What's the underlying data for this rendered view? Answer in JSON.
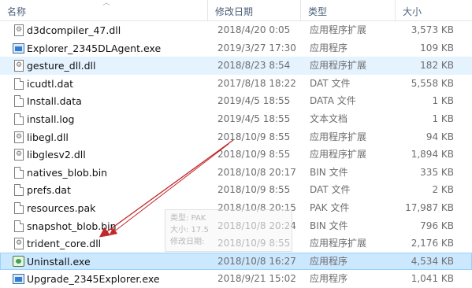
{
  "columns": {
    "name": "名称",
    "modified": "修改日期",
    "type": "类型",
    "size": "大小"
  },
  "files": [
    {
      "name": "d3dcompiler_47.dll",
      "date": "2018/4/20 0:05",
      "type": "应用程序扩展",
      "size": "3,573 KB",
      "icon": "gear-file-icon",
      "state": "normal"
    },
    {
      "name": "Explorer_2345DLAgent.exe",
      "date": "2019/3/27 17:30",
      "type": "应用程序",
      "size": "109 KB",
      "icon": "exe-icon",
      "state": "normal"
    },
    {
      "name": "gesture_dll.dll",
      "date": "2018/8/23 8:54",
      "type": "应用程序扩展",
      "size": "182 KB",
      "icon": "gear-file-icon",
      "state": "hover"
    },
    {
      "name": "icudtl.dat",
      "date": "2017/8/18 18:22",
      "type": "DAT 文件",
      "size": "5,558 KB",
      "icon": "document-icon",
      "state": "normal"
    },
    {
      "name": "Install.data",
      "date": "2019/4/5 18:55",
      "type": "DATA 文件",
      "size": "1 KB",
      "icon": "document-icon",
      "state": "normal"
    },
    {
      "name": "install.log",
      "date": "2019/4/5 18:55",
      "type": "文本文档",
      "size": "1 KB",
      "icon": "document-icon",
      "state": "normal"
    },
    {
      "name": "libegl.dll",
      "date": "2018/10/9 8:55",
      "type": "应用程序扩展",
      "size": "94 KB",
      "icon": "gear-file-icon",
      "state": "normal"
    },
    {
      "name": "libglesv2.dll",
      "date": "2018/10/9 8:55",
      "type": "应用程序扩展",
      "size": "1,894 KB",
      "icon": "gear-file-icon",
      "state": "normal"
    },
    {
      "name": "natives_blob.bin",
      "date": "2018/10/8 20:17",
      "type": "BIN 文件",
      "size": "335 KB",
      "icon": "document-icon",
      "state": "normal"
    },
    {
      "name": "prefs.dat",
      "date": "2018/10/9 8:55",
      "type": "DAT 文件",
      "size": "2 KB",
      "icon": "document-icon",
      "state": "normal"
    },
    {
      "name": "resources.pak",
      "date": "2018/10/8 20:15",
      "type": "PAK 文件",
      "size": "17,987 KB",
      "icon": "document-icon",
      "state": "normal"
    },
    {
      "name": "snapshot_blob.bin",
      "date": "2018/10/8 20:24",
      "type": "BIN 文件",
      "size": "796 KB",
      "icon": "document-icon",
      "state": "normal"
    },
    {
      "name": "trident_core.dll",
      "date": "2018/10/9 8:55",
      "type": "应用程序扩展",
      "size": "2,176 KB",
      "icon": "gear-file-icon",
      "state": "normal"
    },
    {
      "name": "Uninstall.exe",
      "date": "2018/10/8 16:27",
      "type": "应用程序",
      "size": "4,534 KB",
      "icon": "uninstall-icon",
      "state": "selected"
    },
    {
      "name": "Upgrade_2345Explorer.exe",
      "date": "2018/9/21 15:02",
      "type": "应用程序",
      "size": "1,041 KB",
      "icon": "exe-icon",
      "state": "normal"
    }
  ],
  "tooltip": {
    "type_line": "类型: PAK",
    "size_line": "大小: 17.5",
    "date_line": "修改日期:"
  },
  "colors": {
    "header_text": "#4c607a",
    "hover_row": "#e5f3ff",
    "selected_row": "#cce8ff",
    "selected_border": "#99d1ff",
    "annotation_arrow": "#c0282a"
  }
}
